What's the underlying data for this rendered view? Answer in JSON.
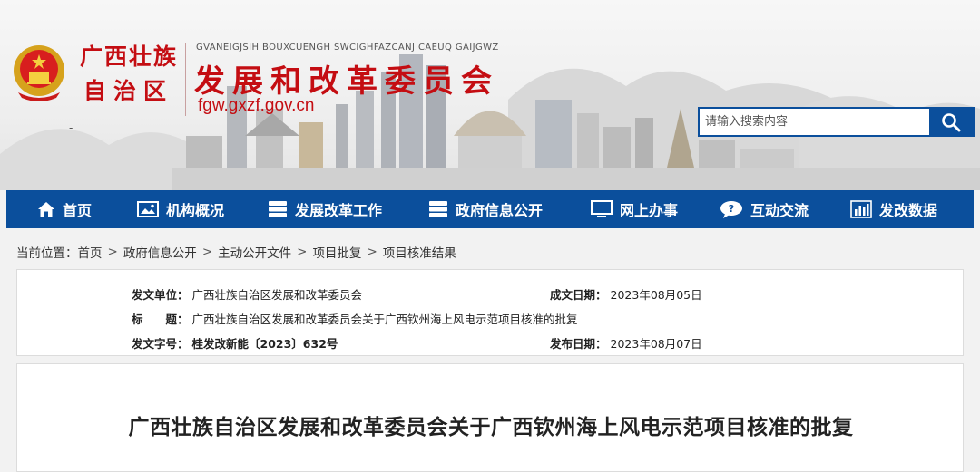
{
  "header": {
    "region_line1": "广西壮族",
    "region_line2": "自治区",
    "zhuang_name": "GVANEIGJSIH BOUXCUENGH SWCIGHFAZCANJ CAEUQ GAIJGWZ",
    "org_title": "发展和改革委员会",
    "domain": "fgw.gxzf.gov.cn",
    "dash": "-",
    "search": {
      "placeholder": "请输入搜索内容"
    },
    "brand_color": "#c40d12",
    "nav_color": "#0b4f9c"
  },
  "nav": {
    "items": [
      {
        "label": "首页",
        "icon": "home-icon"
      },
      {
        "label": "机构概况",
        "icon": "image-icon"
      },
      {
        "label": "发展改革工作",
        "icon": "server-icon"
      },
      {
        "label": "政府信息公开",
        "icon": "server-icon"
      },
      {
        "label": "网上办事",
        "icon": "monitor-icon"
      },
      {
        "label": "互动交流",
        "icon": "chat-icon"
      },
      {
        "label": "发改数据",
        "icon": "bar-chart-icon"
      }
    ]
  },
  "breadcrumb": {
    "prefix": "当前位置：",
    "items": [
      "首页",
      "政府信息公开",
      "主动公开文件",
      "项目批复",
      "项目核准结果"
    ],
    "separator": ">"
  },
  "meta": {
    "issuer_label": "发文单位：",
    "issuer": "广西壮族自治区发展和改革委员会",
    "created_label": "成文日期：",
    "created": "2023年08月05日",
    "title_label": "标　　题：",
    "title": "广西壮族自治区发展和改革委员会关于广西钦州海上风电示范项目核准的批复",
    "docno_label": "发文字号：",
    "docno": "桂发改新能〔2023〕632号",
    "published_label": "发布日期：",
    "published": "2023年08月07日"
  },
  "article": {
    "title": "广西壮族自治区发展和改革委员会关于广西钦州海上风电示范项目核准的批复"
  }
}
